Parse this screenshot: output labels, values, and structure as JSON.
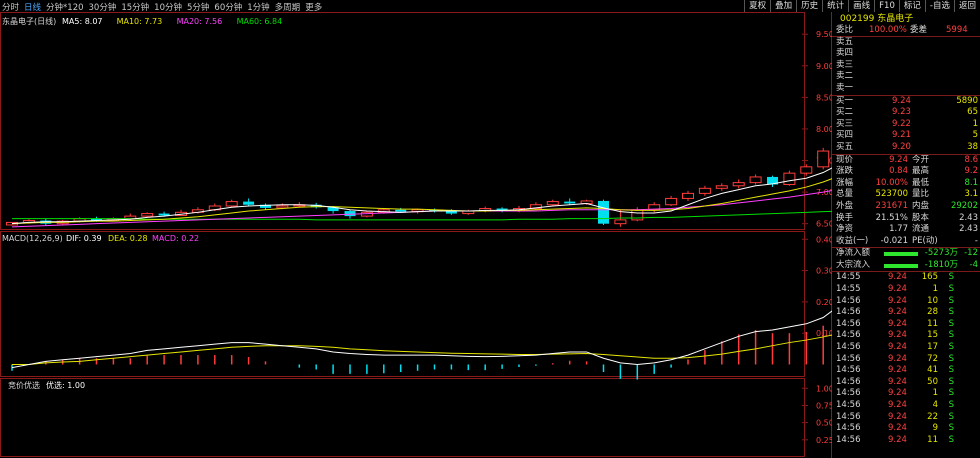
{
  "periods": [
    "分时",
    "日线",
    "分钟*120",
    "30分钟",
    "15分钟",
    "10分钟",
    "5分钟",
    "60分钟",
    "1分钟",
    "多周期",
    "更多"
  ],
  "active_period": "日线",
  "tools": [
    "夏权",
    "叠加",
    "历史",
    "统计",
    "画线",
    "F10",
    "标记",
    "-自选",
    "返回"
  ],
  "stock": {
    "code": "002199",
    "name": "东晶电子"
  },
  "main_chart": {
    "title": "东晶电子(日线)",
    "ma": [
      {
        "label": "MA5: 8.07",
        "color": "#ffffff"
      },
      {
        "label": "MA10: 7.73",
        "color": "#e6e600"
      },
      {
        "label": "MA20: 7.56",
        "color": "#ff40ff"
      },
      {
        "label": "MA60: 6.84",
        "color": "#00dd00"
      }
    ],
    "yticks": [
      "9.50",
      "9.00",
      "8.50",
      "8.00",
      "7.50",
      "7.00",
      "6.50"
    ]
  },
  "macd_chart": {
    "title": "MACD(12,26,9)",
    "dif": "DIF: 0.39",
    "dea": "DEA: 0.28",
    "macd": "MACD: 0.22",
    "yticks": [
      "0.40",
      "0.30",
      "0.20",
      "0.10"
    ]
  },
  "bid_chart": {
    "title": "竞价优选",
    "line": "优选: 1.00",
    "yticks": [
      "1.00",
      "0.75",
      "0.50",
      "0.25"
    ]
  },
  "chart_data": {
    "type": "candlestick",
    "ylim": [
      6.4,
      9.82
    ],
    "candles": [
      [
        6.48,
        6.52,
        6.52,
        6.47
      ],
      [
        6.52,
        6.55,
        6.57,
        6.5
      ],
      [
        6.55,
        6.5,
        6.58,
        6.47
      ],
      [
        6.5,
        6.54,
        6.56,
        6.48
      ],
      [
        6.54,
        6.58,
        6.6,
        6.52
      ],
      [
        6.58,
        6.55,
        6.61,
        6.53
      ],
      [
        6.55,
        6.58,
        6.6,
        6.54
      ],
      [
        6.58,
        6.62,
        6.66,
        6.56
      ],
      [
        6.62,
        6.66,
        6.68,
        6.6
      ],
      [
        6.66,
        6.63,
        6.69,
        6.61
      ],
      [
        6.63,
        6.68,
        6.72,
        6.62
      ],
      [
        6.68,
        6.72,
        6.76,
        6.66
      ],
      [
        6.72,
        6.78,
        6.82,
        6.7
      ],
      [
        6.78,
        6.85,
        6.88,
        6.76
      ],
      [
        6.85,
        6.8,
        6.9,
        6.78
      ],
      [
        6.8,
        6.75,
        6.82,
        6.72
      ],
      [
        6.75,
        6.78,
        6.82,
        6.73
      ],
      [
        6.78,
        6.8,
        6.84,
        6.76
      ],
      [
        6.8,
        6.76,
        6.83,
        6.74
      ],
      [
        6.76,
        6.7,
        6.78,
        6.66
      ],
      [
        6.7,
        6.62,
        6.72,
        6.58
      ],
      [
        6.62,
        6.68,
        6.7,
        6.6
      ],
      [
        6.68,
        6.72,
        6.74,
        6.66
      ],
      [
        6.72,
        6.69,
        6.75,
        6.67
      ],
      [
        6.69,
        6.72,
        6.74,
        6.66
      ],
      [
        6.72,
        6.7,
        6.74,
        6.68
      ],
      [
        6.7,
        6.66,
        6.73,
        6.64
      ],
      [
        6.66,
        6.7,
        6.72,
        6.64
      ],
      [
        6.7,
        6.74,
        6.77,
        6.68
      ],
      [
        6.74,
        6.7,
        6.76,
        6.68
      ],
      [
        6.7,
        6.74,
        6.78,
        6.68
      ],
      [
        6.74,
        6.8,
        6.84,
        6.72
      ],
      [
        6.8,
        6.85,
        6.88,
        6.78
      ],
      [
        6.85,
        6.82,
        6.9,
        6.8
      ],
      [
        6.82,
        6.86,
        6.88,
        6.8
      ],
      [
        6.86,
        6.5,
        6.88,
        6.48
      ],
      [
        6.5,
        6.56,
        6.72,
        6.45
      ],
      [
        6.56,
        6.72,
        6.76,
        6.54
      ],
      [
        6.72,
        6.8,
        6.84,
        6.68
      ],
      [
        6.8,
        6.9,
        6.94,
        6.78
      ],
      [
        6.9,
        6.98,
        7.02,
        6.86
      ],
      [
        6.98,
        7.06,
        7.1,
        6.94
      ],
      [
        7.06,
        7.1,
        7.14,
        7.02
      ],
      [
        7.1,
        7.15,
        7.2,
        7.06
      ],
      [
        7.15,
        7.24,
        7.28,
        7.12
      ],
      [
        7.24,
        7.12,
        7.26,
        7.08
      ],
      [
        7.12,
        7.3,
        7.34,
        7.1
      ],
      [
        7.3,
        7.4,
        7.44,
        7.26
      ],
      [
        7.4,
        7.65,
        7.7,
        7.36
      ],
      [
        7.65,
        8.02,
        8.05,
        7.6
      ],
      [
        8.02,
        8.4,
        8.5,
        7.9
      ],
      [
        8.4,
        8.62,
        8.7,
        8.35
      ],
      [
        8.62,
        9.68,
        9.7,
        8.55
      ],
      [
        8.0,
        7.78,
        8.02,
        7.74
      ],
      [
        7.78,
        7.72,
        7.82,
        7.65
      ],
      [
        7.52,
        7.28,
        7.54,
        7.24
      ],
      [
        7.28,
        7.22,
        7.3,
        7.18
      ],
      [
        7.22,
        7.26,
        7.34,
        7.2
      ],
      [
        7.26,
        7.52,
        7.58,
        7.24
      ],
      [
        7.52,
        7.58,
        7.64,
        7.46
      ],
      [
        7.58,
        7.54,
        7.6,
        7.48
      ],
      [
        7.54,
        7.58,
        7.62,
        7.5
      ],
      [
        7.58,
        7.52,
        7.6,
        7.46
      ],
      [
        7.52,
        7.54,
        7.58,
        7.48
      ],
      [
        7.54,
        7.6,
        7.68,
        7.52
      ],
      [
        7.6,
        7.95,
        8.0,
        7.58
      ],
      [
        7.95,
        8.38,
        8.42,
        7.85
      ],
      [
        8.38,
        9.24,
        9.24,
        8.3
      ]
    ],
    "ma5": [
      6.5,
      6.52,
      6.53,
      6.53,
      6.54,
      6.55,
      6.56,
      6.57,
      6.6,
      6.62,
      6.65,
      6.68,
      6.72,
      6.76,
      6.78,
      6.79,
      6.8,
      6.8,
      6.79,
      6.76,
      6.72,
      6.7,
      6.69,
      6.68,
      6.69,
      6.7,
      6.7,
      6.7,
      6.71,
      6.71,
      6.72,
      6.75,
      6.78,
      6.8,
      6.82,
      6.75,
      6.69,
      6.67,
      6.67,
      6.7,
      6.8,
      6.9,
      6.98,
      7.04,
      7.1,
      7.13,
      7.18,
      7.22,
      7.31,
      7.45,
      7.68,
      7.95,
      8.3,
      8.55,
      8.7,
      8.72,
      8.35,
      7.95,
      7.65,
      7.45,
      7.4,
      7.45,
      7.48,
      7.52,
      7.54,
      7.62,
      7.75,
      7.98
    ],
    "ma10": [
      6.5,
      6.51,
      6.52,
      6.52,
      6.53,
      6.54,
      6.54,
      6.55,
      6.56,
      6.57,
      6.59,
      6.61,
      6.64,
      6.67,
      6.7,
      6.72,
      6.74,
      6.76,
      6.77,
      6.77,
      6.76,
      6.75,
      6.74,
      6.73,
      6.73,
      6.72,
      6.71,
      6.7,
      6.7,
      6.71,
      6.71,
      6.72,
      6.73,
      6.74,
      6.75,
      6.74,
      6.72,
      6.71,
      6.71,
      6.72,
      6.74,
      6.78,
      6.82,
      6.87,
      6.92,
      6.97,
      7.02,
      7.08,
      7.16,
      7.26,
      7.38,
      7.52,
      7.68,
      7.85,
      8.0,
      8.12,
      8.15,
      8.1,
      8.0,
      7.9,
      7.82,
      7.75,
      7.68,
      7.64,
      7.62,
      7.62,
      7.66,
      7.73
    ],
    "ma20": [
      6.45,
      6.46,
      6.47,
      6.48,
      6.49,
      6.5,
      6.51,
      6.52,
      6.53,
      6.54,
      6.55,
      6.56,
      6.57,
      6.58,
      6.59,
      6.6,
      6.61,
      6.62,
      6.63,
      6.64,
      6.65,
      6.66,
      6.67,
      6.68,
      6.69,
      6.7,
      6.7,
      6.7,
      6.7,
      6.7,
      6.7,
      6.7,
      6.71,
      6.72,
      6.72,
      6.72,
      6.72,
      6.72,
      6.73,
      6.74,
      6.76,
      6.78,
      6.8,
      6.83,
      6.86,
      6.89,
      6.92,
      6.96,
      7.0,
      7.05,
      7.1,
      7.16,
      7.22,
      7.28,
      7.32,
      7.35,
      7.38,
      7.4,
      7.42,
      7.43,
      7.45,
      7.46,
      7.47,
      7.49,
      7.5,
      7.52,
      7.54,
      7.56
    ],
    "ma60": [
      6.58,
      6.58,
      6.58,
      6.58,
      6.58,
      6.58,
      6.58,
      6.58,
      6.57,
      6.57,
      6.57,
      6.57,
      6.57,
      6.57,
      6.57,
      6.57,
      6.57,
      6.57,
      6.56,
      6.56,
      6.56,
      6.56,
      6.56,
      6.56,
      6.56,
      6.56,
      6.56,
      6.56,
      6.56,
      6.56,
      6.57,
      6.57,
      6.57,
      6.58,
      6.58,
      6.58,
      6.59,
      6.59,
      6.6,
      6.6,
      6.61,
      6.62,
      6.63,
      6.64,
      6.65,
      6.66,
      6.67,
      6.68,
      6.69,
      6.7,
      6.71,
      6.72,
      6.73,
      6.74,
      6.75,
      6.76,
      6.77,
      6.78,
      6.79,
      6.79,
      6.8,
      6.81,
      6.81,
      6.82,
      6.82,
      6.83,
      6.83,
      6.84
    ],
    "macd_ylim": [
      -0.04,
      0.42
    ],
    "dif": [
      -0.01,
      0.0,
      0.01,
      0.015,
      0.02,
      0.025,
      0.03,
      0.035,
      0.045,
      0.05,
      0.055,
      0.06,
      0.065,
      0.07,
      0.07,
      0.065,
      0.06,
      0.055,
      0.05,
      0.04,
      0.035,
      0.032,
      0.03,
      0.03,
      0.03,
      0.03,
      0.028,
      0.026,
      0.025,
      0.026,
      0.028,
      0.03,
      0.035,
      0.04,
      0.04,
      0.02,
      0.005,
      0.0,
      0.005,
      0.015,
      0.03,
      0.05,
      0.07,
      0.09,
      0.105,
      0.11,
      0.12,
      0.13,
      0.15,
      0.19,
      0.25,
      0.31,
      0.38,
      0.4,
      0.39,
      0.37,
      0.32,
      0.26,
      0.22,
      0.2,
      0.18,
      0.17,
      0.16,
      0.15,
      0.15,
      0.17,
      0.26,
      0.39
    ],
    "dea": [
      0.0,
      0.0,
      0.005,
      0.008,
      0.01,
      0.015,
      0.02,
      0.025,
      0.03,
      0.035,
      0.04,
      0.045,
      0.05,
      0.055,
      0.058,
      0.06,
      0.06,
      0.06,
      0.058,
      0.055,
      0.05,
      0.047,
      0.044,
      0.042,
      0.04,
      0.038,
      0.036,
      0.035,
      0.034,
      0.033,
      0.032,
      0.032,
      0.033,
      0.034,
      0.035,
      0.032,
      0.028,
      0.024,
      0.02,
      0.02,
      0.022,
      0.027,
      0.033,
      0.042,
      0.05,
      0.06,
      0.07,
      0.078,
      0.088,
      0.1,
      0.12,
      0.145,
      0.18,
      0.22,
      0.25,
      0.26,
      0.27,
      0.27,
      0.265,
      0.26,
      0.25,
      0.24,
      0.235,
      0.23,
      0.225,
      0.22,
      0.24,
      0.28
    ],
    "macd": [
      -0.02,
      0.0,
      0.01,
      0.014,
      0.02,
      0.02,
      0.02,
      0.02,
      0.03,
      0.03,
      0.03,
      0.03,
      0.03,
      0.03,
      0.024,
      0.01,
      0.0,
      -0.01,
      -0.016,
      -0.03,
      -0.03,
      -0.03,
      -0.028,
      -0.024,
      -0.02,
      -0.016,
      -0.016,
      -0.018,
      -0.018,
      -0.014,
      -0.008,
      -0.004,
      0.004,
      0.012,
      0.01,
      -0.024,
      -0.046,
      -0.048,
      -0.03,
      -0.01,
      0.016,
      0.046,
      0.074,
      0.096,
      0.11,
      0.1,
      0.1,
      0.104,
      0.124,
      0.18,
      0.26,
      0.33,
      0.4,
      0.36,
      0.28,
      0.22,
      0.1,
      -0.02,
      -0.09,
      -0.12,
      -0.14,
      -0.14,
      -0.15,
      -0.16,
      -0.15,
      -0.1,
      0.04,
      0.22
    ],
    "bid": [
      0,
      0,
      0,
      0,
      0,
      0,
      0,
      0,
      0,
      0,
      0,
      0,
      0,
      0,
      0,
      0,
      0,
      0,
      0,
      0,
      0,
      0,
      0,
      0,
      0,
      0,
      0,
      0,
      0,
      0,
      0,
      0,
      0,
      0,
      0,
      0,
      0,
      0,
      0,
      0,
      0,
      0,
      0,
      0,
      0,
      0,
      0,
      0,
      0,
      0,
      0,
      0,
      0,
      0,
      0,
      0,
      0,
      0,
      0,
      0,
      0,
      0,
      0,
      0,
      0,
      0,
      0,
      1.0
    ]
  },
  "quote": {
    "webi": {
      "label": "委比",
      "v1": "100.00%",
      "l2": "委差",
      "v2": "5994"
    },
    "sells": [
      {
        "label": "卖五",
        "price": "",
        "vol": ""
      },
      {
        "label": "卖四",
        "price": "",
        "vol": ""
      },
      {
        "label": "卖三",
        "price": "",
        "vol": ""
      },
      {
        "label": "卖二",
        "price": "",
        "vol": ""
      },
      {
        "label": "卖一",
        "price": "",
        "vol": ""
      }
    ],
    "buys": [
      {
        "label": "买一",
        "price": "9.24",
        "vol": "5890"
      },
      {
        "label": "买二",
        "price": "9.23",
        "vol": "65"
      },
      {
        "label": "买三",
        "price": "9.22",
        "vol": "1"
      },
      {
        "label": "买四",
        "price": "9.21",
        "vol": "5"
      },
      {
        "label": "买五",
        "price": "9.20",
        "vol": "38"
      }
    ],
    "stats": [
      {
        "l1": "现价",
        "v1": "9.24",
        "l2": "今开",
        "v2": "8.6"
      },
      {
        "l1": "涨跌",
        "v1": "0.84",
        "l2": "最高",
        "v2": "9.2"
      },
      {
        "l1": "涨幅",
        "v1": "10.00%",
        "l2": "最低",
        "v2": "8.1"
      },
      {
        "l1": "总量",
        "v1": "523700",
        "l2": "量比",
        "v2": "3.1"
      },
      {
        "l1": "外盘",
        "v1": "231671",
        "l2": "内盘",
        "v2": "29202"
      },
      {
        "l1": "换手",
        "v1": "21.51%",
        "l2": "股本",
        "v2": "2.43"
      },
      {
        "l1": "净资",
        "v1": "1.77",
        "l2": "流通",
        "v2": "2.43"
      },
      {
        "l1": "收益(一)",
        "v1": "-0.021",
        "l2": "PE(动)",
        "v2": "-"
      }
    ],
    "flows": [
      {
        "label": "净流入额",
        "value": "-5273万",
        "pct": "-12"
      },
      {
        "label": "大宗流入",
        "value": "-1810万",
        "pct": "-4"
      }
    ],
    "trades": [
      {
        "t": "14:55",
        "p": "9.24",
        "v": "165",
        "s": "S"
      },
      {
        "t": "14:55",
        "p": "9.24",
        "v": "1",
        "s": "S"
      },
      {
        "t": "14:56",
        "p": "9.24",
        "v": "10",
        "s": "S"
      },
      {
        "t": "14:56",
        "p": "9.24",
        "v": "28",
        "s": "S"
      },
      {
        "t": "14:56",
        "p": "9.24",
        "v": "11",
        "s": "S"
      },
      {
        "t": "14:56",
        "p": "9.24",
        "v": "15",
        "s": "S"
      },
      {
        "t": "14:56",
        "p": "9.24",
        "v": "17",
        "s": "S"
      },
      {
        "t": "14:56",
        "p": "9.24",
        "v": "72",
        "s": "S"
      },
      {
        "t": "14:56",
        "p": "9.24",
        "v": "41",
        "s": "S"
      },
      {
        "t": "14:56",
        "p": "9.24",
        "v": "50",
        "s": "S"
      },
      {
        "t": "14:56",
        "p": "9.24",
        "v": "1",
        "s": "S"
      },
      {
        "t": "14:56",
        "p": "9.24",
        "v": "4",
        "s": "S"
      },
      {
        "t": "14:56",
        "p": "9.24",
        "v": "22",
        "s": "S"
      },
      {
        "t": "14:56",
        "p": "9.24",
        "v": "9",
        "s": "S"
      },
      {
        "t": "14:56",
        "p": "9.24",
        "v": "11",
        "s": "S"
      }
    ]
  },
  "colors": {
    "up": "#ff3c3c",
    "down": "#00e0f0",
    "ma5": "#ffffff",
    "ma10": "#e6e600",
    "ma20": "#ff40ff",
    "ma60": "#00dd00",
    "grid": "#8a1a1a"
  }
}
